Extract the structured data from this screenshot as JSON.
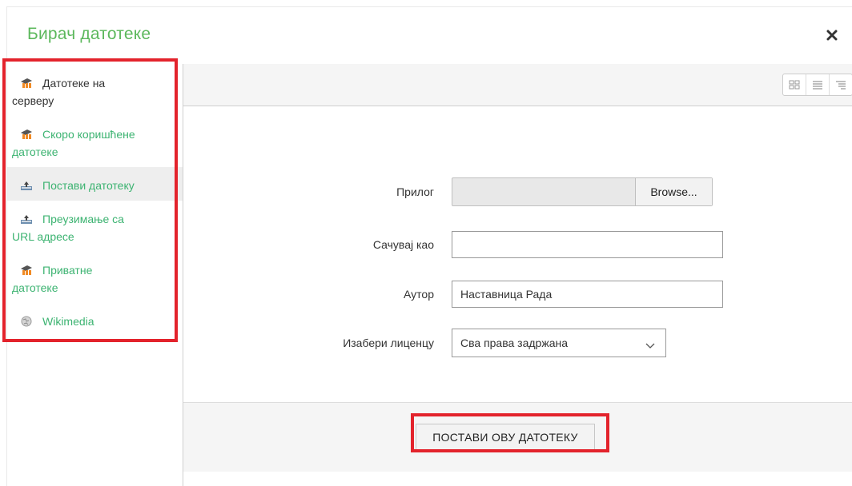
{
  "dialog": {
    "title": "Бирач датотеке"
  },
  "sidebar": {
    "items": [
      {
        "line1": "Датотеке на",
        "line2": "серверу",
        "icon": "moodle-icon"
      },
      {
        "line1": "Скоро коришћене",
        "line2": "датотеке",
        "icon": "moodle-icon"
      },
      {
        "line1": "Постави датотеку",
        "line2": "",
        "icon": "upload-icon"
      },
      {
        "line1": "Преузимање са",
        "line2": "URL адресе",
        "icon": "upload-icon"
      },
      {
        "line1": "Приватне",
        "line2": "датотеке",
        "icon": "moodle-icon"
      },
      {
        "line1": "Wikimedia",
        "line2": "",
        "icon": "wikimedia-icon"
      }
    ]
  },
  "toolbar": {
    "views": [
      "icons-view",
      "list-view",
      "tree-view"
    ]
  },
  "form": {
    "attachment_label": "Прилог",
    "browse_label": "Browse...",
    "save_as_label": "Сачувај као",
    "save_as_value": "",
    "author_label": "Аутор",
    "author_value": "Наставница Рада",
    "license_label": "Изабери лиценцу",
    "license_value": "Сва права задржана"
  },
  "footer": {
    "upload_label": "ПОСТАВИ ОВУ ДАТОТЕКУ"
  },
  "colors": {
    "title": "#5cb85c",
    "link": "#3cb371",
    "highlight": "#e3232c"
  }
}
